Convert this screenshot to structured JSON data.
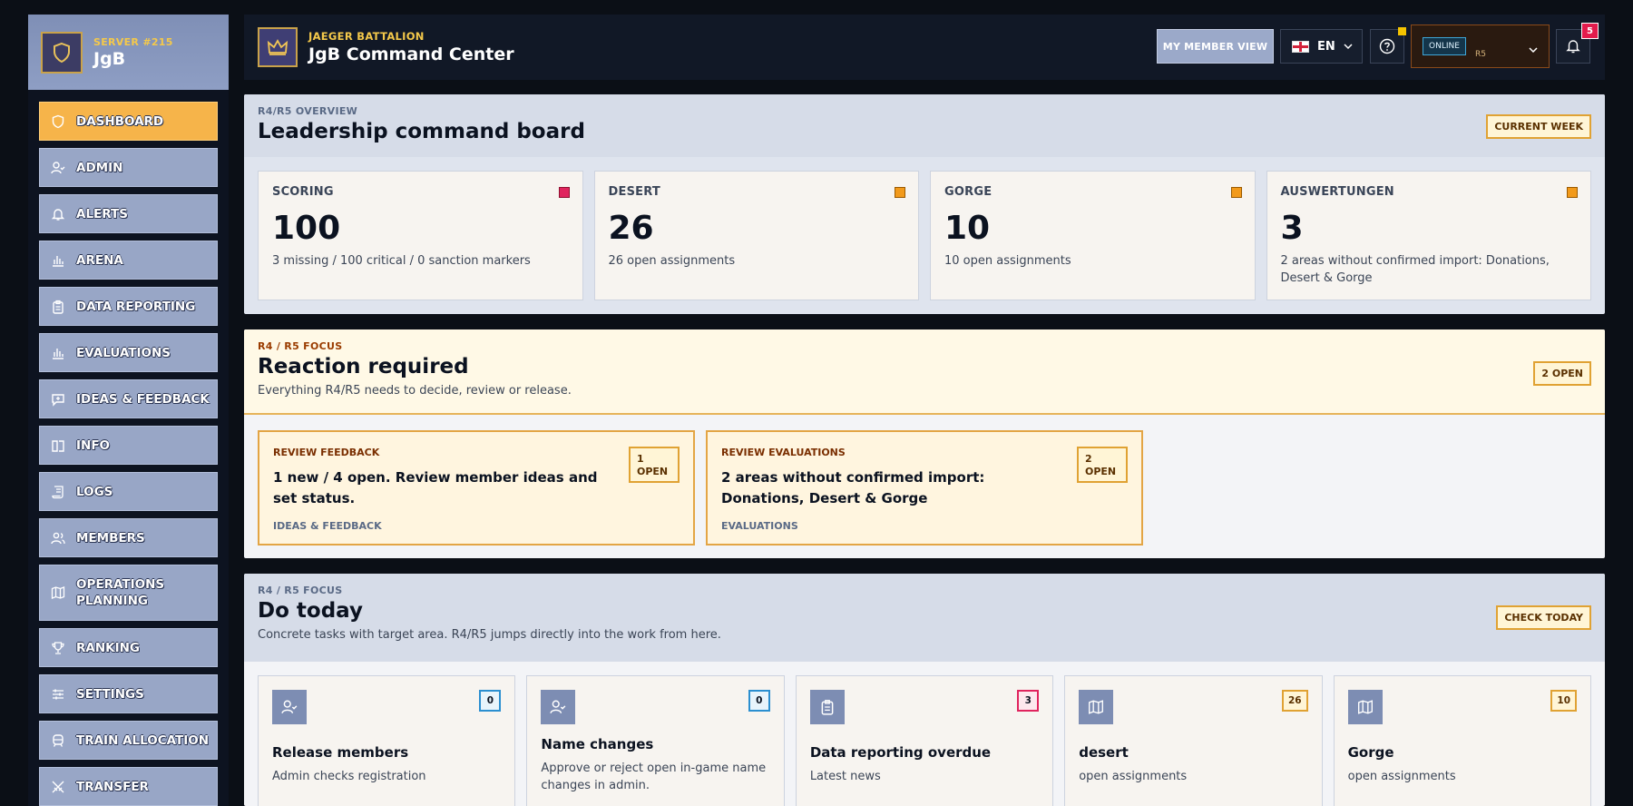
{
  "sidebar": {
    "server": "SERVER #215",
    "name": "JgB",
    "items": [
      {
        "label": "DASHBOARD",
        "icon": "shield-icon",
        "active": true
      },
      {
        "label": "ADMIN",
        "icon": "user-check-icon"
      },
      {
        "label": "ALERTS",
        "icon": "bell-icon"
      },
      {
        "label": "ARENA",
        "icon": "bar-chart-icon"
      },
      {
        "label": "DATA REPORTING",
        "icon": "clipboard-icon"
      },
      {
        "label": "EVALUATIONS",
        "icon": "bar-chart-icon"
      },
      {
        "label": "IDEAS & FEEDBACK",
        "icon": "message-plus-icon"
      },
      {
        "label": "INFO",
        "icon": "book-open-icon"
      },
      {
        "label": "LOGS",
        "icon": "scroll-icon"
      },
      {
        "label": "MEMBERS",
        "icon": "users-icon"
      },
      {
        "label": "OPERATIONS PLANNING",
        "icon": "map-icon"
      },
      {
        "label": "RANKING",
        "icon": "trophy-icon"
      },
      {
        "label": "SETTINGS",
        "icon": "sliders-icon"
      },
      {
        "label": "TRAIN ALLOCATION",
        "icon": "train-icon"
      },
      {
        "label": "TRANSFER",
        "icon": "swords-icon"
      }
    ]
  },
  "header": {
    "org": "JAEGER BATTALION",
    "title": "JgB Command Center",
    "member_view": "MY MEMBER VIEW",
    "lang": "EN",
    "status": "ONLINE",
    "rank": "R5",
    "notifications": "5"
  },
  "overview": {
    "eyebrow": "R4/R5 OVERVIEW",
    "title": "Leadership command board",
    "tag": "CURRENT WEEK",
    "stats": [
      {
        "label": "SCORING",
        "value": "100",
        "desc": "3 missing / 100 critical / 0 sanction markers",
        "color": "#e0245e"
      },
      {
        "label": "DESERT",
        "value": "26",
        "desc": "26 open assignments",
        "color": "#f29a1b"
      },
      {
        "label": "GORGE",
        "value": "10",
        "desc": "10 open assignments",
        "color": "#f29a1b"
      },
      {
        "label": "AUSWERTUNGEN",
        "value": "3",
        "desc": "2 areas without confirmed import: Donations, Desert & Gorge",
        "color": "#f29a1b"
      }
    ]
  },
  "reaction": {
    "eyebrow": "R4 / R5 FOCUS",
    "title": "Reaction required",
    "subtitle": "Everything R4/R5 needs to decide, review or release.",
    "tag": "2 OPEN",
    "cards": [
      {
        "label": "REVIEW FEEDBACK",
        "text": "1 new / 4 open. Review member ideas and set status.",
        "foot": "IDEAS & FEEDBACK",
        "tag1": "1",
        "tag2": "OPEN"
      },
      {
        "label": "REVIEW EVALUATIONS",
        "text": "2 areas without confirmed import: Donations, Desert & Gorge",
        "foot": "EVALUATIONS",
        "tag1": "2",
        "tag2": "OPEN"
      }
    ]
  },
  "today": {
    "eyebrow": "R4 / R5 FOCUS",
    "title": "Do today",
    "subtitle": "Concrete tasks with target area. R4/R5 jumps directly into the work from here.",
    "tag": "CHECK TODAY",
    "tasks": [
      {
        "title": "Release members",
        "desc": "Admin checks registration",
        "badge": "0",
        "icon": "user-check-icon",
        "badge_color": "#2b8fd0"
      },
      {
        "title": "Name changes",
        "desc": "Approve or reject open in-game name changes in admin.",
        "badge": "0",
        "icon": "user-check-icon",
        "badge_color": "#2b8fd0"
      },
      {
        "title": "Data reporting overdue",
        "desc": "Latest news",
        "badge": "3",
        "icon": "clipboard-icon",
        "badge_color": "#e0245e"
      },
      {
        "title": "desert",
        "desc": "open assignments",
        "badge": "26",
        "icon": "map-icon",
        "badge_color": "#e0a233"
      },
      {
        "title": "Gorge",
        "desc": "open assignments",
        "badge": "10",
        "icon": "map-icon",
        "badge_color": "#e0a233"
      }
    ]
  }
}
